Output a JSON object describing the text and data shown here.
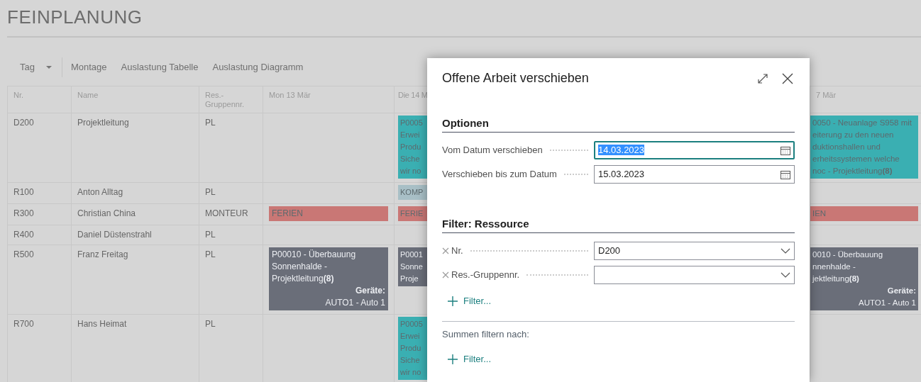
{
  "page": {
    "title": "FEINPLANUNG"
  },
  "toolbar": {
    "view_menu": {
      "label": "Tag"
    },
    "actions": [
      "Montage",
      "Auslastung Tabelle",
      "Auslastung Diagramm"
    ]
  },
  "table": {
    "columns": [
      "Nr.",
      "Name",
      "Res.-Gruppennr.",
      "Mon 13 Mär",
      "Die 14 M",
      "7 Mär"
    ],
    "rows": [
      {
        "nr": "D200",
        "name": "Projektleitung",
        "group": "PL",
        "day_2": {
          "color": "#3aafb2",
          "lines": [
            "P0005",
            "Erwei",
            "Produ",
            "Siche",
            "wir no"
          ]
        },
        "day_3": {
          "color": "#3aafb2",
          "lines": [
            "0050 - Neuanlage S958 mit",
            "eiterung zu den neuen",
            "duktionshallen und",
            "erheitssystemen welche",
            "noc - Projektleitung**(8)**"
          ]
        }
      },
      {
        "nr": "R100",
        "name": "Anton Alltag",
        "group": "PL",
        "day_2": {
          "color": "#a8bfc6",
          "lines": [
            "KOMP"
          ]
        }
      },
      {
        "nr": "R300",
        "name": "Christian China",
        "group": "MONTEUR",
        "day_1": {
          "color": "#c97775",
          "lines": [
            "FERIEN"
          ]
        },
        "day_2": {
          "color": "#c97775",
          "lines": [
            "FERIE"
          ]
        },
        "day_3": {
          "color": "#c97775",
          "lines": [
            "IEN"
          ]
        }
      },
      {
        "nr": "R400",
        "name": "Daniel Düstenstrahl",
        "group": "PL"
      },
      {
        "nr": "R500",
        "name": "Franz Freitag",
        "group": "PL",
        "day_1": {
          "color": "#6a6e79",
          "lines": [
            "P00010 - Überbauung",
            "Sonnenhalde -",
            "Projektleitung**(8)**"
          ],
          "device_label": "Geräte:",
          "device": "AUTO1 - Auto 1"
        },
        "day_2": {
          "color": "#6a6e79",
          "lines": [
            "P0001",
            "Sonne",
            "Proje"
          ]
        },
        "day_3": {
          "color": "#6a6e79",
          "lines": [
            "0010 - Überbauung",
            "nnenhalde -",
            "jektleitung**(8)**"
          ],
          "device_label": "Geräte:",
          "device": "AUTO1 - Auto 1"
        }
      },
      {
        "nr": "R700",
        "name": "Hans Heimat",
        "group": "PL",
        "day_2": {
          "color": "#3aafb2",
          "lines": [
            "P0005",
            "Erwei",
            "Produ",
            "Siche",
            "wir no"
          ]
        }
      }
    ]
  },
  "dialog": {
    "title": "Offene Arbeit verschieben",
    "sections": [
      {
        "heading": "Optionen",
        "fields": [
          {
            "label": "Vom Datum verschieben",
            "value": "14.03.2023",
            "kind": "date",
            "focused": true,
            "removable": false
          },
          {
            "label": "Verschieben bis zum Datum",
            "value": "15.03.2023",
            "kind": "date",
            "focused": false,
            "removable": false
          }
        ]
      },
      {
        "heading": "Filter: Ressource",
        "fields": [
          {
            "label": "Nr.",
            "value": "D200",
            "kind": "dropdown",
            "focused": false,
            "removable": true
          },
          {
            "label": "Res.-Gruppennr.",
            "kind": "dropdown",
            "focused": false,
            "removable": true
          }
        ],
        "add_filter": "Filter..."
      }
    ],
    "totals": {
      "label": "Summen filtern nach:",
      "add_filter": "Filter..."
    }
  }
}
